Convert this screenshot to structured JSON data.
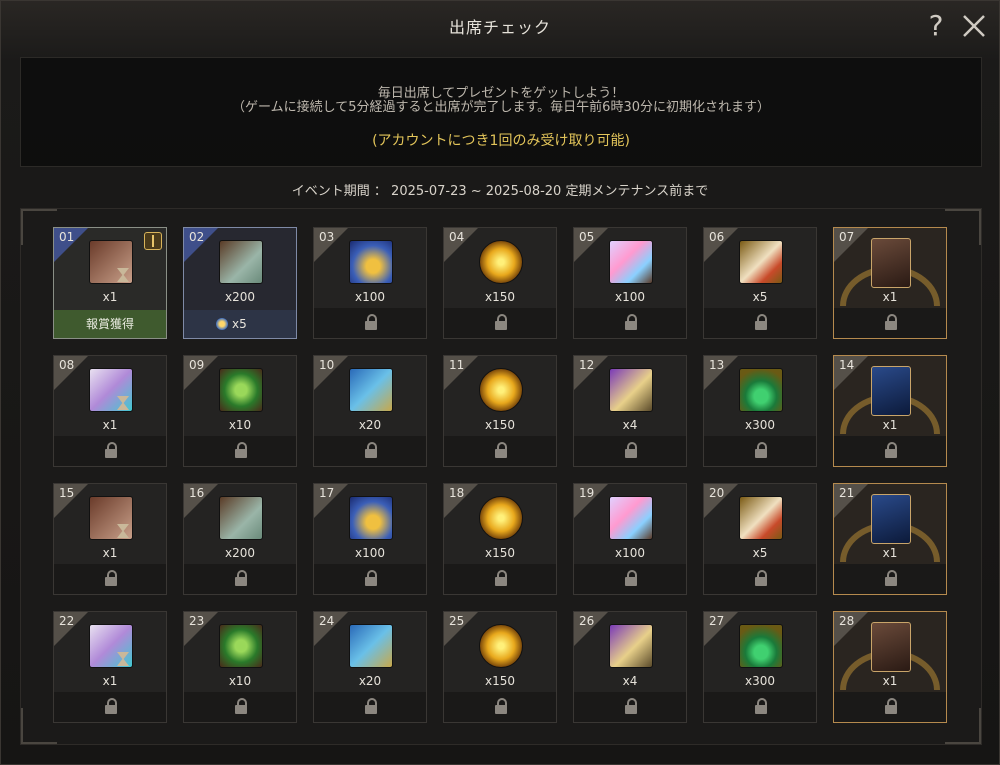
{
  "window": {
    "title": "出席チェック",
    "help_label": "?"
  },
  "info": {
    "line1": "毎日出席してプレゼントをゲットしよう！",
    "line2": "（ゲームに接続して5分経過すると出席が完了します。毎日午前6時30分に初期化されます）",
    "line3": "(アカウントにつき1回のみ受け取り可能)"
  },
  "period": "イベント期間 ： 2025-07-23 ~ 2025-08-20 定期メンテナンス前まで",
  "colors": {
    "claimed": "#3f5a2e",
    "highlight_border": "#b58a4e",
    "notice_text": "#e3c55a"
  },
  "days": [
    {
      "num": "01",
      "qty": "x1",
      "icon": "coupon-icon",
      "state": "claimed",
      "status_label": "報賞獲得"
    },
    {
      "num": "02",
      "qty": "x200",
      "icon": "scroll-icon",
      "state": "today",
      "bonus": "x5"
    },
    {
      "num": "03",
      "qty": "x100",
      "icon": "treasure-chest-icon",
      "state": "locked"
    },
    {
      "num": "04",
      "qty": "x150",
      "icon": "gold-orb-icon",
      "state": "locked"
    },
    {
      "num": "05",
      "qty": "x100",
      "icon": "crystal-shards-icon",
      "state": "locked"
    },
    {
      "num": "06",
      "qty": "x5",
      "icon": "feather-icon",
      "state": "locked"
    },
    {
      "num": "07",
      "qty": "x1",
      "icon": "card-pack-icon",
      "state": "locked",
      "special": true
    },
    {
      "num": "08",
      "qty": "x1",
      "icon": "gift-box-icon",
      "state": "locked"
    },
    {
      "num": "09",
      "qty": "x10",
      "icon": "green-heart-icon",
      "state": "locked"
    },
    {
      "num": "10",
      "qty": "x20",
      "icon": "blue-scroll-icon",
      "state": "locked"
    },
    {
      "num": "11",
      "qty": "x150",
      "icon": "gold-orb-icon",
      "state": "locked"
    },
    {
      "num": "12",
      "qty": "x4",
      "icon": "rune-stone-icon",
      "state": "locked"
    },
    {
      "num": "13",
      "qty": "x300",
      "icon": "green-potion-icon",
      "state": "locked"
    },
    {
      "num": "14",
      "qty": "x1",
      "icon": "blue-card-icon",
      "state": "locked",
      "special": true
    },
    {
      "num": "15",
      "qty": "x1",
      "icon": "coupon-icon",
      "state": "locked"
    },
    {
      "num": "16",
      "qty": "x200",
      "icon": "scroll-icon",
      "state": "locked"
    },
    {
      "num": "17",
      "qty": "x100",
      "icon": "treasure-chest-icon",
      "state": "locked"
    },
    {
      "num": "18",
      "qty": "x150",
      "icon": "gold-orb-icon",
      "state": "locked"
    },
    {
      "num": "19",
      "qty": "x100",
      "icon": "crystal-shards-icon",
      "state": "locked"
    },
    {
      "num": "20",
      "qty": "x5",
      "icon": "feather-icon",
      "state": "locked"
    },
    {
      "num": "21",
      "qty": "x1",
      "icon": "blue-card-icon",
      "state": "locked",
      "special": true
    },
    {
      "num": "22",
      "qty": "x1",
      "icon": "gift-box-icon",
      "state": "locked"
    },
    {
      "num": "23",
      "qty": "x10",
      "icon": "green-heart-icon",
      "state": "locked"
    },
    {
      "num": "24",
      "qty": "x20",
      "icon": "blue-scroll-icon",
      "state": "locked"
    },
    {
      "num": "25",
      "qty": "x150",
      "icon": "gold-orb-icon",
      "state": "locked"
    },
    {
      "num": "26",
      "qty": "x4",
      "icon": "rune-stone-icon",
      "state": "locked"
    },
    {
      "num": "27",
      "qty": "x300",
      "icon": "green-potion-icon",
      "state": "locked"
    },
    {
      "num": "28",
      "qty": "x1",
      "icon": "card-pack-icon",
      "state": "locked",
      "special": true
    }
  ]
}
